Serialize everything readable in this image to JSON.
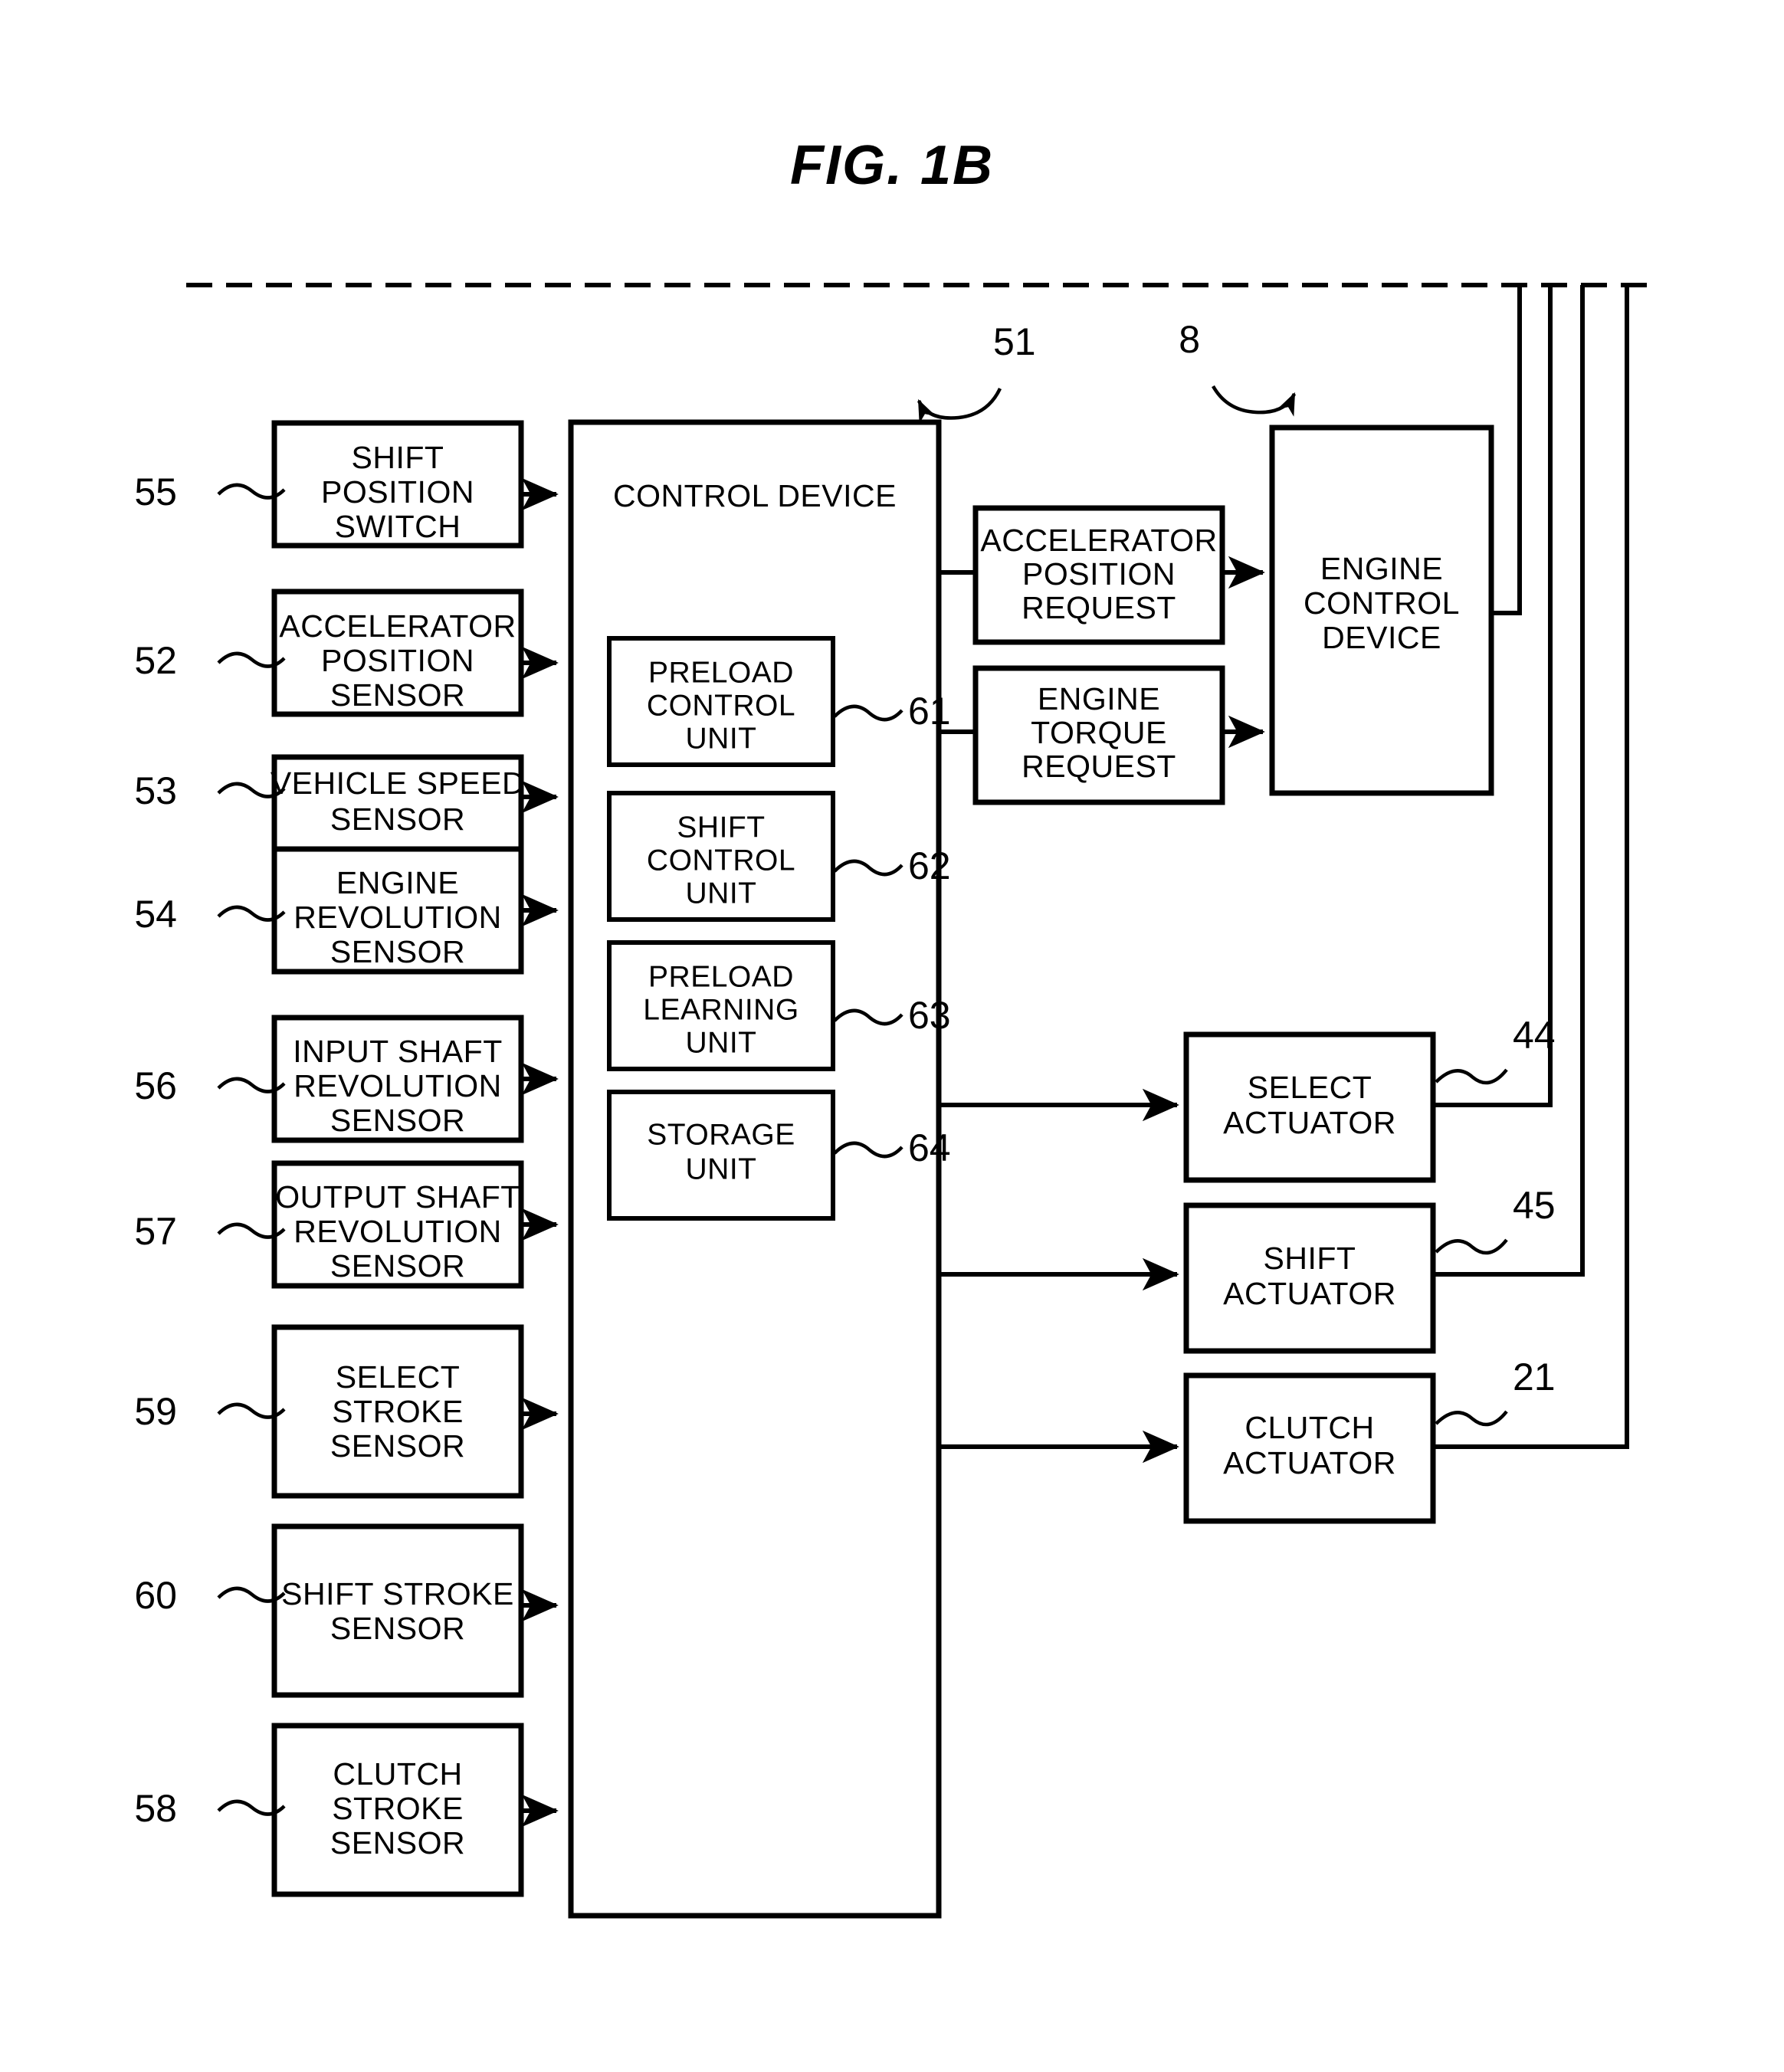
{
  "figure": {
    "title": "FIG. 1B"
  },
  "sensors": [
    {
      "ref": "55",
      "lines": [
        "SHIFT",
        "POSITION",
        "SWITCH"
      ]
    },
    {
      "ref": "52",
      "lines": [
        "ACCELERATOR",
        "POSITION",
        "SENSOR"
      ]
    },
    {
      "ref": "53",
      "lines": [
        "VEHICLE SPEED",
        "SENSOR"
      ]
    },
    {
      "ref": "54",
      "lines": [
        "ENGINE",
        "REVOLUTION",
        "SENSOR"
      ]
    },
    {
      "ref": "56",
      "lines": [
        "INPUT SHAFT",
        "REVOLUTION",
        "SENSOR"
      ]
    },
    {
      "ref": "57",
      "lines": [
        "OUTPUT SHAFT",
        "REVOLUTION",
        "SENSOR"
      ]
    },
    {
      "ref": "59",
      "lines": [
        "SELECT",
        "STROKE",
        "SENSOR"
      ]
    },
    {
      "ref": "60",
      "lines": [
        "SHIFT STROKE",
        "SENSOR"
      ]
    },
    {
      "ref": "58",
      "lines": [
        "CLUTCH",
        "STROKE",
        "SENSOR"
      ]
    }
  ],
  "control_device": {
    "ref": "51",
    "title": "CONTROL DEVICE",
    "units": [
      {
        "ref": "61",
        "lines": [
          "PRELOAD",
          "CONTROL",
          "UNIT"
        ]
      },
      {
        "ref": "62",
        "lines": [
          "SHIFT",
          "CONTROL",
          "UNIT"
        ]
      },
      {
        "ref": "63",
        "lines": [
          "PRELOAD",
          "LEARNING",
          "UNIT"
        ]
      },
      {
        "ref": "64",
        "lines": [
          "STORAGE",
          "UNIT"
        ]
      }
    ]
  },
  "requests": [
    {
      "lines": [
        "ACCELERATOR",
        "POSITION",
        "REQUEST"
      ]
    },
    {
      "lines": [
        "ENGINE",
        "TORQUE",
        "REQUEST"
      ]
    }
  ],
  "engine_control_device": {
    "ref": "8",
    "lines": [
      "ENGINE",
      "CONTROL",
      "DEVICE"
    ]
  },
  "actuators": [
    {
      "ref": "44",
      "lines": [
        "SELECT",
        "ACTUATOR"
      ]
    },
    {
      "ref": "45",
      "lines": [
        "SHIFT",
        "ACTUATOR"
      ]
    },
    {
      "ref": "21",
      "lines": [
        "CLUTCH",
        "ACTUATOR"
      ]
    }
  ],
  "colors": {
    "ink": "#000000",
    "paper": "#ffffff"
  }
}
